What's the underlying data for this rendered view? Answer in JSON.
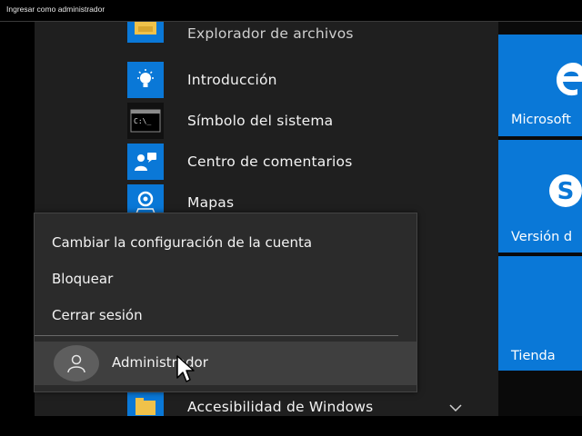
{
  "window": {
    "title": "Ingresar como administrador"
  },
  "apps": [
    {
      "label": "Explorador de archivos",
      "icon": "folder-icon"
    },
    {
      "label": "Introducción",
      "icon": "lightbulb-icon"
    },
    {
      "label": "Símbolo del sistema",
      "icon": "command-prompt-icon"
    },
    {
      "label": "Centro de comentarios",
      "icon": "feedback-icon"
    },
    {
      "label": "Mapas",
      "icon": "maps-icon"
    },
    {
      "label": "Accesibilidad de Windows",
      "icon": "folder-icon"
    }
  ],
  "tiles": [
    {
      "label": "Microsoft",
      "icon": "edge-icon"
    },
    {
      "label": "Versión d",
      "icon": "skype-icon"
    },
    {
      "label": "Tienda",
      "icon": "store-icon"
    }
  ],
  "account_menu": {
    "items": [
      {
        "label": "Cambiar la configuración de la cuenta"
      },
      {
        "label": "Bloquear"
      },
      {
        "label": "Cerrar sesión"
      }
    ],
    "user": {
      "name": "Administrador"
    }
  },
  "colors": {
    "accent": "#0a78d7",
    "menu_bg": "#1f1f1f",
    "popup_bg": "#2b2b2b",
    "hover_bg": "#3f3f3f"
  }
}
